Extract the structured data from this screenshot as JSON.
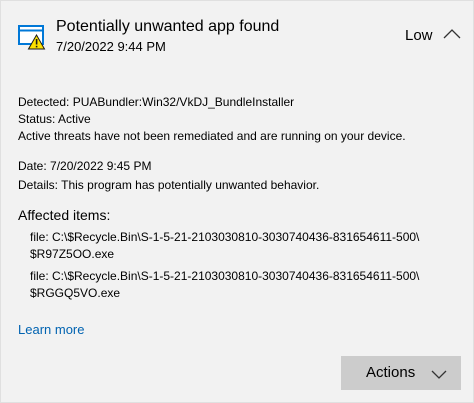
{
  "notification": {
    "icon": "app-warning-icon",
    "title": "Potentially unwanted app found",
    "timestamp": "7/20/2022 9:44 PM",
    "severity": "Low",
    "collapse_icon": "chevron-up-icon"
  },
  "details": {
    "detected_label": "Detected:",
    "detected_value": "PUABundler:Win32/VkDJ_BundleInstaller",
    "status_label": "Status:",
    "status_value": "Active",
    "status_note": "Active threats have not been remediated and are running on your device.",
    "date_label": "Date:",
    "date_value": "7/20/2022 9:45 PM",
    "details_label": "Details:",
    "details_value": "This program has potentially unwanted behavior."
  },
  "affected": {
    "title": "Affected items:",
    "items": [
      {
        "line1": "file: C:\\$Recycle.Bin\\S-1-5-21-2103030810-3030740436-831654611-500\\",
        "line2": "$R97Z5OO.exe"
      },
      {
        "line1": "file: C:\\$Recycle.Bin\\S-1-5-21-2103030810-3030740436-831654611-500\\",
        "line2": "$RGGQ5VO.exe"
      }
    ]
  },
  "links": {
    "learn_more": "Learn more"
  },
  "actions": {
    "label": "Actions",
    "icon": "chevron-down-icon"
  },
  "colors": {
    "card_background": "#f2f2f2",
    "link": "#0063b1",
    "button_background": "#cccccc",
    "icon_blue": "#0078d7",
    "warning_yellow": "#fce100"
  }
}
